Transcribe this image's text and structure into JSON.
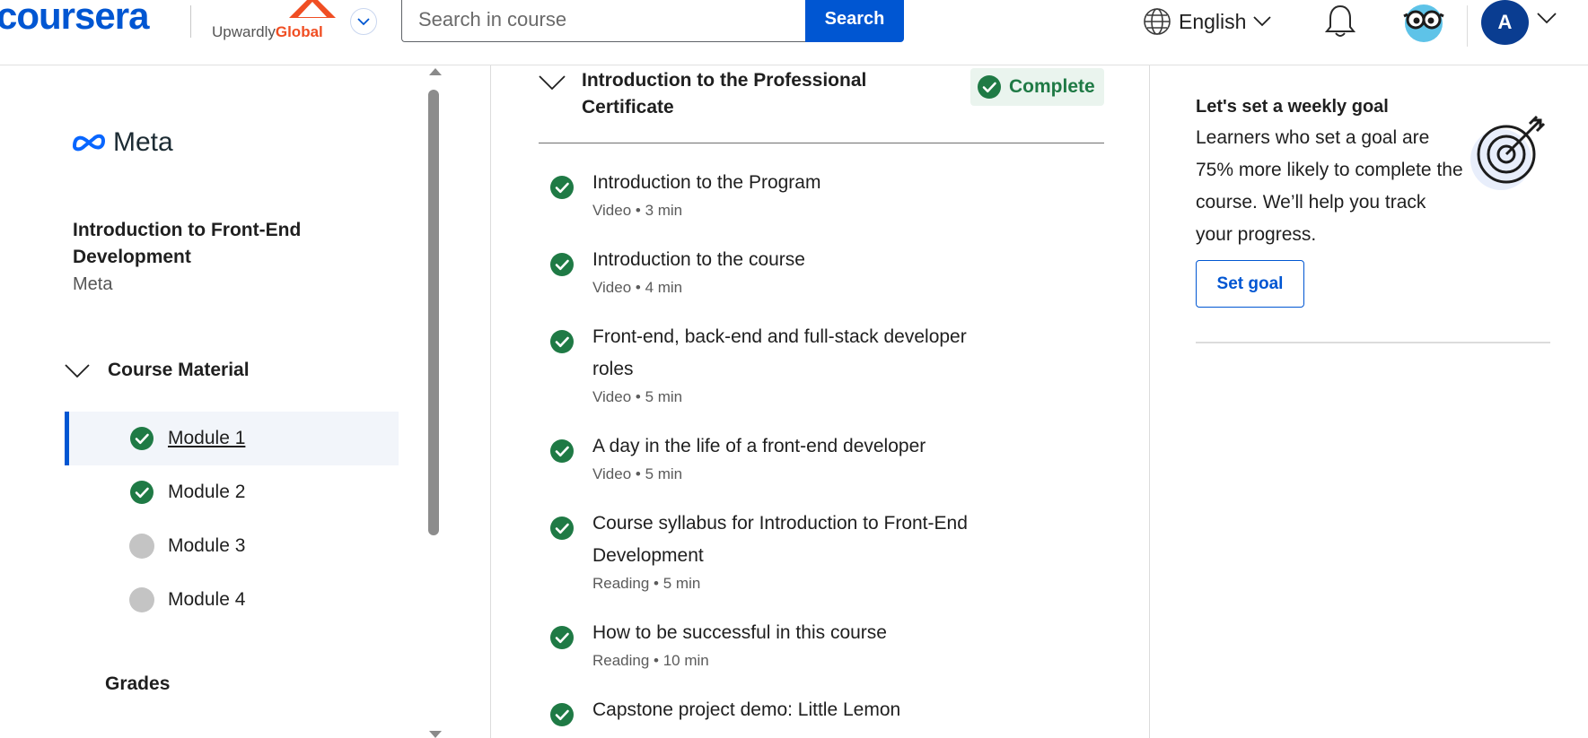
{
  "header": {
    "logo_text": "coursera",
    "partner": {
      "name_part1": "Upwardly",
      "name_part2": "Global"
    },
    "search": {
      "placeholder": "Search in course",
      "value": "",
      "button_label": "Search"
    },
    "language": "English",
    "avatar_initial": "A"
  },
  "sidebar": {
    "brand": "Meta",
    "course_title": "Introduction to Front-End Development",
    "course_partner": "Meta",
    "material_label": "Course Material",
    "modules": [
      {
        "label": "Module 1",
        "status": "complete",
        "active": true
      },
      {
        "label": "Module 2",
        "status": "complete",
        "active": false
      },
      {
        "label": "Module 3",
        "status": "incomplete",
        "active": false
      },
      {
        "label": "Module 4",
        "status": "incomplete",
        "active": false
      }
    ],
    "grades_label": "Grades"
  },
  "lesson": {
    "title": "Introduction to the Professional Certificate",
    "status_label": "Complete",
    "items": [
      {
        "title": "Introduction to the Program",
        "meta": "Video • 3 min"
      },
      {
        "title": "Introduction to the course",
        "meta": "Video • 4 min"
      },
      {
        "title": "Front-end, back-end and full-stack developer roles",
        "meta": "Video • 5 min"
      },
      {
        "title": "A day in the life of a front-end developer",
        "meta": "Video • 5 min"
      },
      {
        "title": "Course syllabus for Introduction to Front-End Development",
        "meta": "Reading • 5 min"
      },
      {
        "title": "How to be successful in this course",
        "meta": "Reading • 10 min"
      },
      {
        "title": "Capstone project demo: Little Lemon",
        "meta": ""
      }
    ]
  },
  "goal": {
    "title": "Let's set a weekly goal",
    "text": "Learners who set a goal are 75% more likely to complete the course. We’ll help you track your progress.",
    "button_label": "Set goal"
  },
  "colors": {
    "brand": "#0056d2",
    "complete_green": "#1f7a45",
    "incomplete_gray": "#c4c4c4"
  }
}
